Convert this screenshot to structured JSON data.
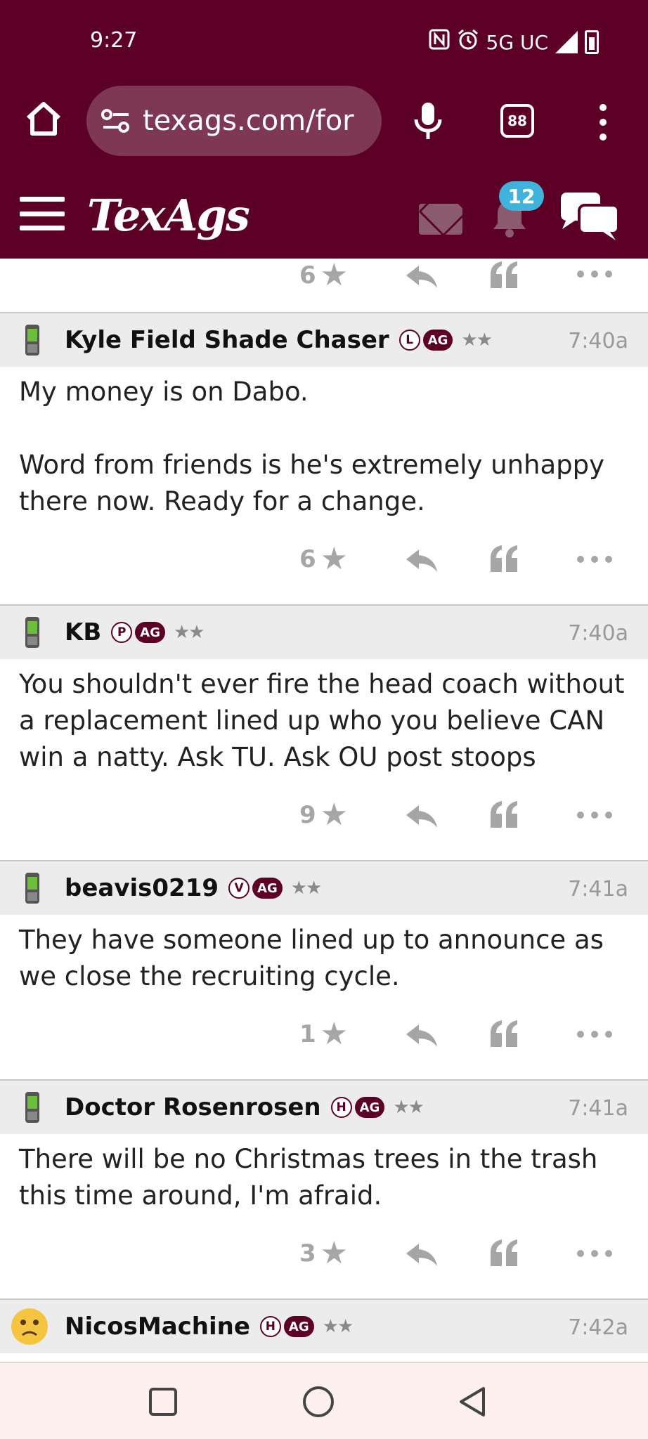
{
  "status_bar": {
    "time": "9:27",
    "network": "5G UC",
    "icons": [
      "nfc-icon",
      "alarm-icon",
      "signal-icon",
      "battery-charging-icon"
    ]
  },
  "browser": {
    "url": "texags.com/for",
    "tab_count": "88",
    "icons": [
      "home-icon",
      "site-settings-icon",
      "mic-icon",
      "tabs-icon",
      "overflow-menu-icon"
    ]
  },
  "site_header": {
    "logo": "TexAgs",
    "notification_count": "12",
    "icons": [
      "hamburger-menu-icon",
      "mail-icon",
      "bell-icon",
      "chat-icon"
    ]
  },
  "partial_top_post": {
    "star_count": "6"
  },
  "posts": [
    {
      "username": "Kyle Field Shade Chaser",
      "level": "L",
      "ag_badge": "AG",
      "rank": "★★",
      "time": "7:40a",
      "body": [
        "My money is on Dabo.",
        "",
        "Word from friends is he's extremely unhappy there now. Ready for a change."
      ],
      "star_count": "6",
      "avatar_icon": "mobile-phone-icon"
    },
    {
      "username": "KB",
      "level": "P",
      "ag_badge": "AG",
      "rank": "★★",
      "time": "7:40a",
      "body": [
        "You shouldn't ever fire the head coach without a replacement lined up who you believe CAN win a natty. Ask TU. Ask OU post stoops"
      ],
      "star_count": "9",
      "avatar_icon": "mobile-phone-icon"
    },
    {
      "username": "beavis0219",
      "level": "V",
      "ag_badge": "AG",
      "rank": "★★",
      "time": "7:41a",
      "body": [
        "They have someone lined up to announce as we close the recruiting cycle."
      ],
      "star_count": "1",
      "avatar_icon": "mobile-phone-icon"
    },
    {
      "username": "Doctor Rosenrosen",
      "level": "H",
      "ag_badge": "AG",
      "rank": "★★",
      "time": "7:41a",
      "body": [
        "There will be no Christmas trees in the trash this time around, I'm afraid."
      ],
      "star_count": "3",
      "avatar_icon": "mobile-phone-icon"
    },
    {
      "username": "NicosMachine",
      "level": "H",
      "ag_badge": "AG",
      "rank": "★★",
      "time": "7:42a",
      "body": [],
      "avatar_icon": "confused-emoji-icon"
    }
  ],
  "colors": {
    "brand_maroon": "#5c0025",
    "header_gray": "#ececec",
    "action_gray": "#a6a6a6",
    "notification_blue": "#3fb3dc"
  },
  "system_nav": {
    "icons": [
      "recents-icon",
      "home-circle-icon",
      "back-icon"
    ]
  }
}
